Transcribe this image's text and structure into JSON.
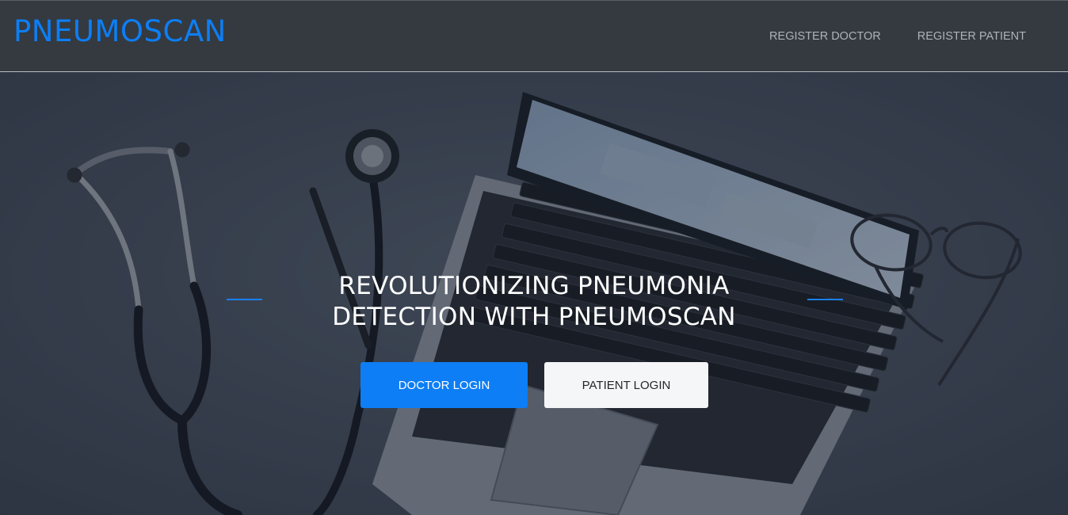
{
  "navbar": {
    "brand": "PNEUMOSCAN",
    "links": [
      {
        "label": "REGISTER DOCTOR"
      },
      {
        "label": "REGISTER PATIENT"
      }
    ]
  },
  "hero": {
    "headline_line1": "REVOLUTIONIZING PNEUMONIA",
    "headline_line2": "DETECTION WITH PNEUMOSCAN",
    "doctor_login_label": "DOCTOR LOGIN",
    "patient_login_label": "PATIENT LOGIN"
  },
  "colors": {
    "brand": "#0d7ef5",
    "navbar_bg": "#343a40",
    "hero_bg": "#434b5b"
  },
  "icons": {
    "background_image": "stethoscope-laptop-desk-photo"
  }
}
